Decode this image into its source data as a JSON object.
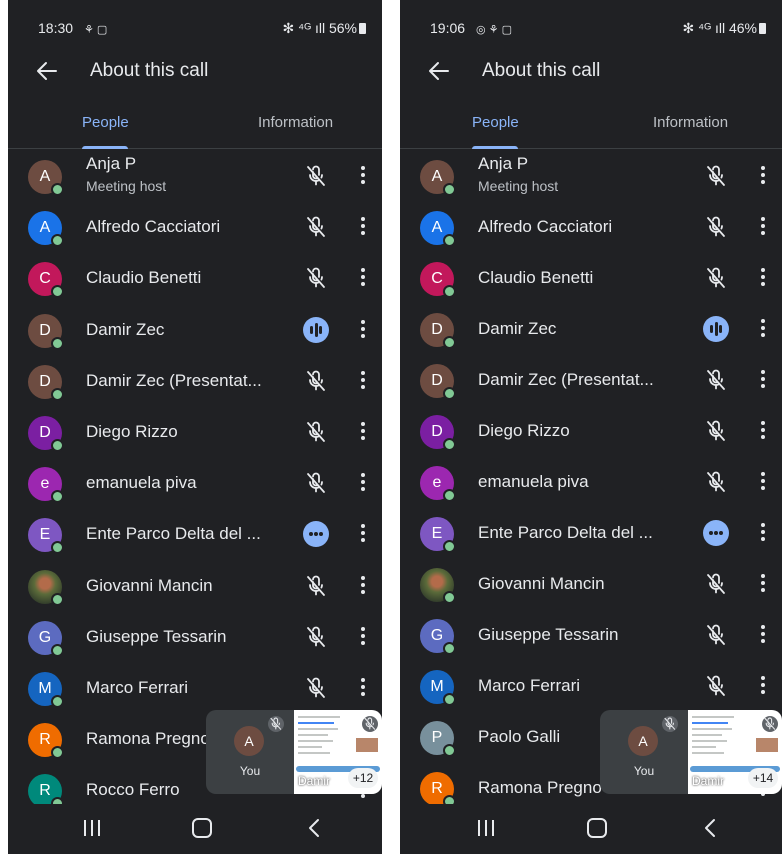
{
  "screens": [
    {
      "status": {
        "time": "18:30",
        "left_icons": "⚘ ▢",
        "right_text": "✻ ⁴ᴳ ıll 56%"
      },
      "title": "About this call",
      "tabs": [
        {
          "label": "People",
          "active": true
        },
        {
          "label": "Information",
          "active": false
        }
      ],
      "participants": [
        {
          "initial": "A",
          "name": "Anja P",
          "subtitle": "Meeting host",
          "color": "#6d4c41",
          "status": "muted"
        },
        {
          "initial": "A",
          "name": "Alfredo Cacciatori",
          "color": "#1a73e8",
          "status": "muted"
        },
        {
          "initial": "C",
          "name": "Claudio Benetti",
          "color": "#c2185b",
          "status": "muted"
        },
        {
          "initial": "D",
          "name": "Damir Zec",
          "color": "#6d4c41",
          "status": "speaking"
        },
        {
          "initial": "D",
          "name": "Damir Zec (Presentat...",
          "color": "#6d4c41",
          "status": "muted"
        },
        {
          "initial": "D",
          "name": "Diego Rizzo",
          "color": "#7b1fa2",
          "status": "muted"
        },
        {
          "initial": "e",
          "name": "emanuela piva",
          "color": "#9c27b0",
          "status": "muted"
        },
        {
          "initial": "E",
          "name": "Ente Parco Delta del ...",
          "color": "#7e57c2",
          "status": "waiting"
        },
        {
          "initial": "",
          "name": "Giovanni Mancin",
          "photo": true,
          "status": "muted"
        },
        {
          "initial": "G",
          "name": "Giuseppe Tessarin",
          "color": "#5c6bc0",
          "status": "muted"
        },
        {
          "initial": "M",
          "name": "Marco Ferrari",
          "color": "#1565c0",
          "status": "muted"
        },
        {
          "initial": "R",
          "name": "Ramona Pregno",
          "color": "#ef6c00",
          "status": "none"
        },
        {
          "initial": "R",
          "name": "Rocco Ferro",
          "color": "#00897b",
          "status": "none"
        }
      ],
      "pip": {
        "self_initial": "A",
        "self_label": "You",
        "presenter_label": "Damir",
        "extra_count": "+12"
      }
    },
    {
      "status": {
        "time": "19:06",
        "left_icons": "◎ ⚘ ▢",
        "right_text": "✻ ⁴ᴳ ıll 46%"
      },
      "title": "About this call",
      "tabs": [
        {
          "label": "People",
          "active": true
        },
        {
          "label": "Information",
          "active": false
        }
      ],
      "participants": [
        {
          "initial": "A",
          "name": "Anja P",
          "subtitle": "Meeting host",
          "color": "#6d4c41",
          "status": "muted"
        },
        {
          "initial": "A",
          "name": "Alfredo Cacciatori",
          "color": "#1a73e8",
          "status": "muted"
        },
        {
          "initial": "C",
          "name": "Claudio Benetti",
          "color": "#c2185b",
          "status": "muted"
        },
        {
          "initial": "D",
          "name": "Damir Zec",
          "color": "#6d4c41",
          "status": "speaking"
        },
        {
          "initial": "D",
          "name": "Damir Zec (Presentat...",
          "color": "#6d4c41",
          "status": "muted"
        },
        {
          "initial": "D",
          "name": "Diego Rizzo",
          "color": "#7b1fa2",
          "status": "muted"
        },
        {
          "initial": "e",
          "name": "emanuela piva",
          "color": "#9c27b0",
          "status": "muted"
        },
        {
          "initial": "E",
          "name": "Ente Parco Delta del ...",
          "color": "#7e57c2",
          "status": "waiting"
        },
        {
          "initial": "",
          "name": "Giovanni Mancin",
          "photo": true,
          "status": "muted"
        },
        {
          "initial": "G",
          "name": "Giuseppe Tessarin",
          "color": "#5c6bc0",
          "status": "muted"
        },
        {
          "initial": "M",
          "name": "Marco Ferrari",
          "color": "#1565c0",
          "status": "muted"
        },
        {
          "initial": "P",
          "name": "Paolo Galli",
          "color": "#78909c",
          "status": "none"
        },
        {
          "initial": "R",
          "name": "Ramona Pregno",
          "color": "#ef6c00",
          "status": "none"
        }
      ],
      "pip": {
        "self_initial": "A",
        "self_label": "You",
        "presenter_label": "Damir",
        "extra_count": "+14"
      }
    }
  ]
}
